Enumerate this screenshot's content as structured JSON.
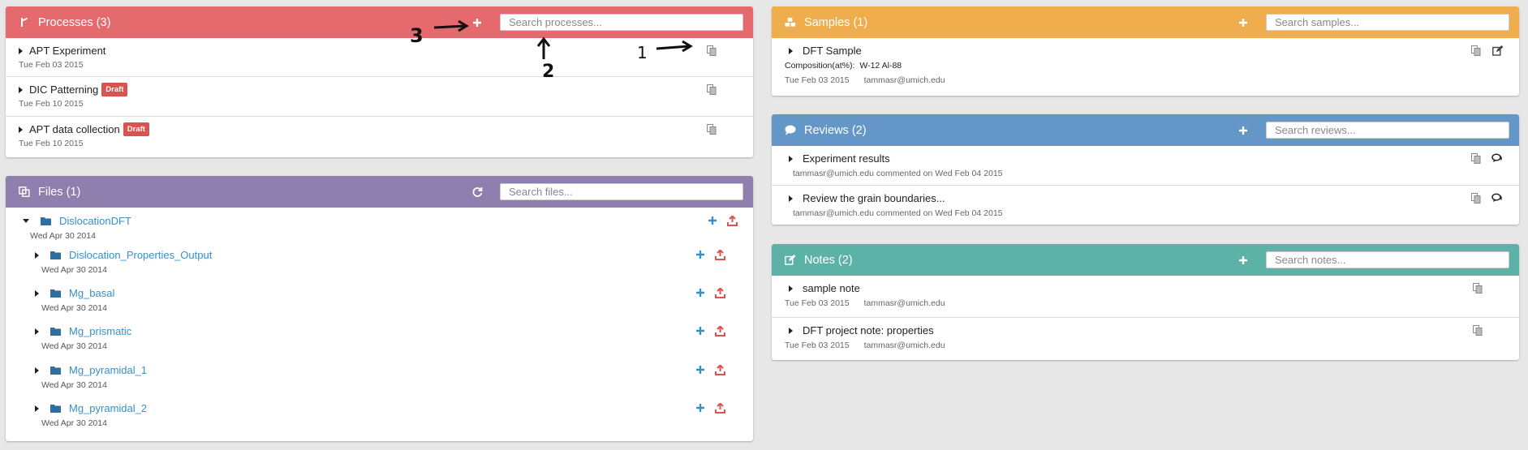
{
  "processes": {
    "title": "Processes (3)",
    "search_placeholder": "Search processes...",
    "items": [
      {
        "name": "APT Experiment",
        "date": "Tue Feb 03 2015",
        "badge": ""
      },
      {
        "name": "DIC Patterning",
        "date": "Tue Feb 10 2015",
        "badge": "Draft"
      },
      {
        "name": "APT data collection",
        "date": "Tue Feb 10 2015",
        "badge": "Draft"
      }
    ]
  },
  "files": {
    "title": "Files (1)",
    "search_placeholder": "Search files...",
    "root": {
      "name": "DislocationDFT",
      "date": "Wed Apr 30 2014"
    },
    "children": [
      {
        "name": "Dislocation_Properties_Output",
        "date": "Wed Apr 30 2014"
      },
      {
        "name": "Mg_basal",
        "date": "Wed Apr 30 2014"
      },
      {
        "name": "Mg_prismatic",
        "date": "Wed Apr 30 2014"
      },
      {
        "name": "Mg_pyramidal_1",
        "date": "Wed Apr 30 2014"
      },
      {
        "name": "Mg_pyramidal_2",
        "date": "Wed Apr 30 2014"
      }
    ]
  },
  "samples": {
    "title": "Samples (1)",
    "search_placeholder": "Search samples...",
    "items": [
      {
        "name": "DFT Sample",
        "composition_label": "Composition(at%):",
        "composition_value": "W-12 Al-88",
        "date": "Tue Feb 03 2015",
        "owner": "tammasr@umich.edu"
      }
    ]
  },
  "reviews": {
    "title": "Reviews (2)",
    "search_placeholder": "Search reviews...",
    "items": [
      {
        "name": "Experiment results",
        "meta": "tammasr@umich.edu commented on Wed Feb 04 2015"
      },
      {
        "name": "Review the grain boundaries...",
        "meta": "tammasr@umich.edu commented on Wed Feb 04 2015"
      }
    ]
  },
  "notes": {
    "title": "Notes (2)",
    "search_placeholder": "Search notes...",
    "items": [
      {
        "name": "sample note",
        "date": "Tue Feb 03 2015",
        "owner": "tammasr@umich.edu"
      },
      {
        "name": "DFT project note: properties",
        "date": "Tue Feb 03 2015",
        "owner": "tammasr@umich.edu"
      }
    ]
  },
  "annotations": {
    "one": "1",
    "two": "2",
    "three": "3"
  },
  "colors": {
    "processes": "#e56a6d",
    "files": "#8e7fae",
    "samples": "#f0ad4e",
    "reviews": "#6497c8",
    "notes": "#5db2a8",
    "link": "#3a8fc6",
    "badge": "#d9534f"
  },
  "icons": {
    "processes": "code-fork-icon",
    "files": "files-icon",
    "samples": "cubes-icon",
    "reviews": "comment-icon",
    "notes": "edit-icon",
    "add": "plus-icon",
    "refresh": "refresh-icon",
    "copy": "copy-icon",
    "upload": "upload-icon",
    "folder": "folder-icon"
  }
}
